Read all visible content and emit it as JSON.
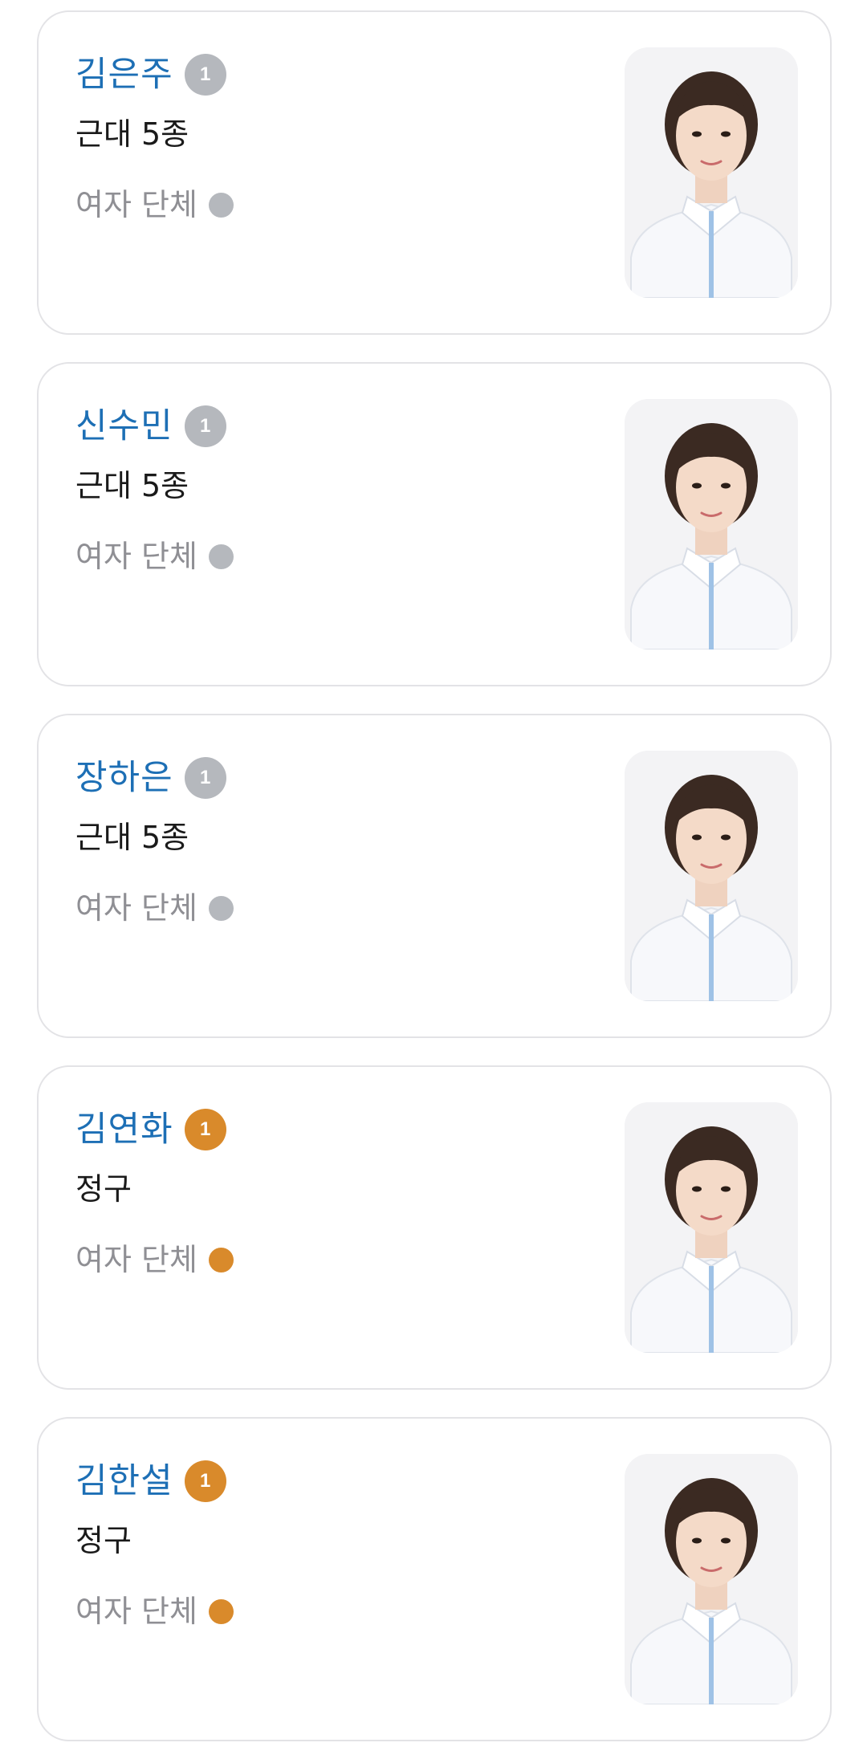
{
  "colors": {
    "name": "#1d6fb5",
    "silver": "#b5b8bd",
    "bronze": "#d98a2b"
  },
  "athletes": [
    {
      "name": "김은주",
      "medal_count": "1",
      "medal": "silver",
      "sport": "근대 5종",
      "event": "여자 단체",
      "photo_icon": "athlete-portrait"
    },
    {
      "name": "신수민",
      "medal_count": "1",
      "medal": "silver",
      "sport": "근대 5종",
      "event": "여자 단체",
      "photo_icon": "athlete-portrait"
    },
    {
      "name": "장하은",
      "medal_count": "1",
      "medal": "silver",
      "sport": "근대 5종",
      "event": "여자 단체",
      "photo_icon": "athlete-portrait"
    },
    {
      "name": "김연화",
      "medal_count": "1",
      "medal": "bronze",
      "sport": "정구",
      "event": "여자 단체",
      "photo_icon": "athlete-portrait"
    },
    {
      "name": "김한설",
      "medal_count": "1",
      "medal": "bronze",
      "sport": "정구",
      "event": "여자 단체",
      "photo_icon": "athlete-portrait"
    }
  ]
}
